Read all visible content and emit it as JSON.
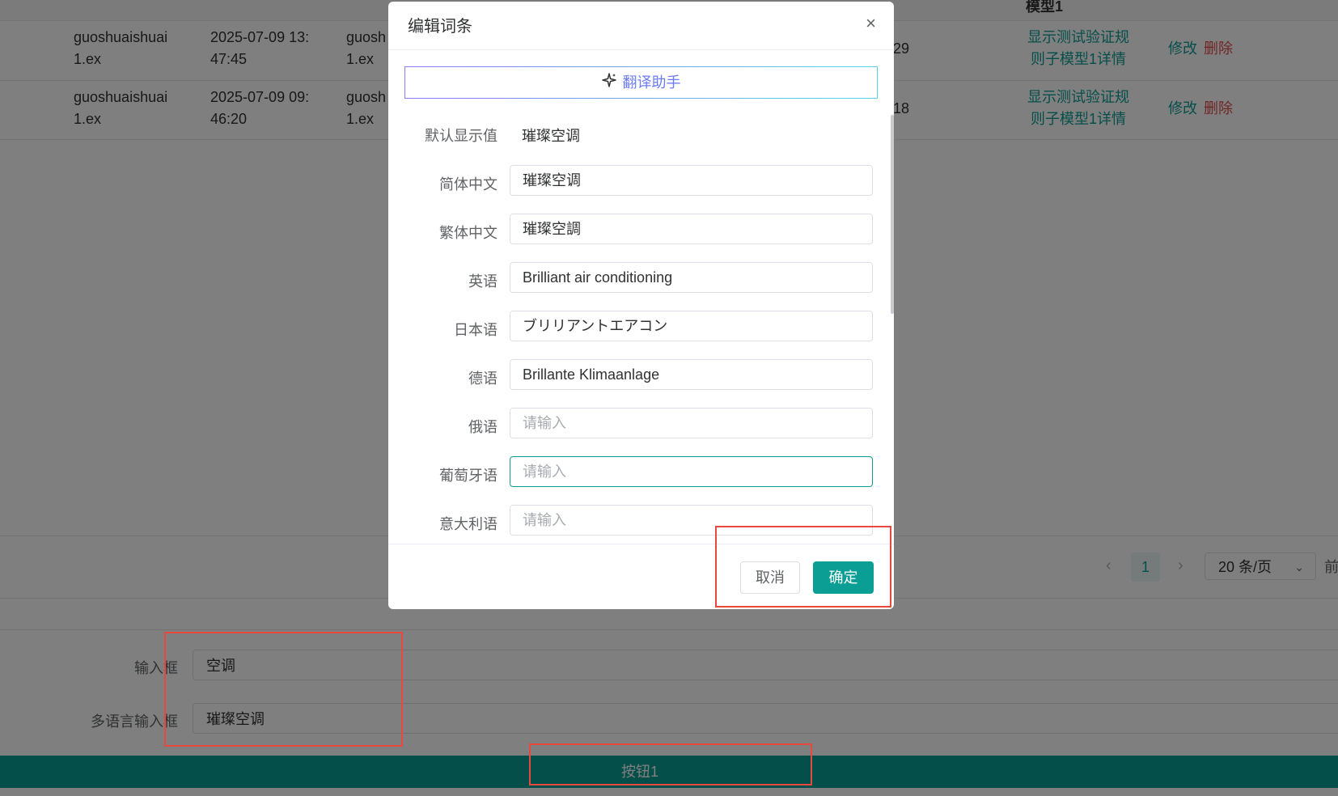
{
  "table": {
    "header_partial": "模型1",
    "rows": [
      {
        "user_line1": "guoshuaishuai",
        "user_line2": "1.ex",
        "time_line1": "2025-07-09 13:",
        "time_line2": "47:45",
        "col3_line1": "guosh",
        "col3_line2": "1.ex",
        "col4": "29",
        "link_line1": "显示测试验证规",
        "link_line2": "则子模型1详情",
        "edit": "修改",
        "delete": "删除"
      },
      {
        "user_line1": "guoshuaishuai",
        "user_line2": "1.ex",
        "time_line1": "2025-07-09 09:",
        "time_line2": "46:20",
        "col3_line1": "guosh",
        "col3_line2": "1.ex",
        "col4": "18",
        "link_line1": "显示测试验证规",
        "link_line2": "则子模型1详情",
        "edit": "修改",
        "delete": "删除"
      }
    ]
  },
  "pagination": {
    "prev": "‹",
    "current_page": "1",
    "next": "›",
    "page_size": "20 条/页",
    "jump_partial": "前"
  },
  "form": {
    "input_label": "输入框",
    "input_value": "空调",
    "multi_label": "多语言输入框",
    "multi_value": "璀璨空调",
    "button1": "按钮1"
  },
  "modal": {
    "title": "编辑词条",
    "close": "×",
    "assist_icon": "sparkle-icon",
    "assist_label": "翻译助手",
    "default_label": "默认显示值",
    "default_value": "璀璨空调",
    "fields": [
      {
        "label": "简体中文",
        "value": "璀璨空调",
        "placeholder": ""
      },
      {
        "label": "繁体中文",
        "value": "璀璨空調",
        "placeholder": ""
      },
      {
        "label": "英语",
        "value": "Brilliant air conditioning",
        "placeholder": ""
      },
      {
        "label": "日本语",
        "value": "ブリリアントエアコン",
        "placeholder": ""
      },
      {
        "label": "德语",
        "value": "Brillante Klimaanlage",
        "placeholder": ""
      },
      {
        "label": "俄语",
        "value": "",
        "placeholder": "请输入"
      },
      {
        "label": "葡萄牙语",
        "value": "",
        "placeholder": "请输入"
      },
      {
        "label": "意大利语",
        "value": "",
        "placeholder": "请输入"
      }
    ],
    "cancel": "取消",
    "confirm": "确定"
  },
  "colors": {
    "accent": "#0b9e95",
    "danger": "#e14b4b",
    "annotation_red": "#e8493f"
  }
}
